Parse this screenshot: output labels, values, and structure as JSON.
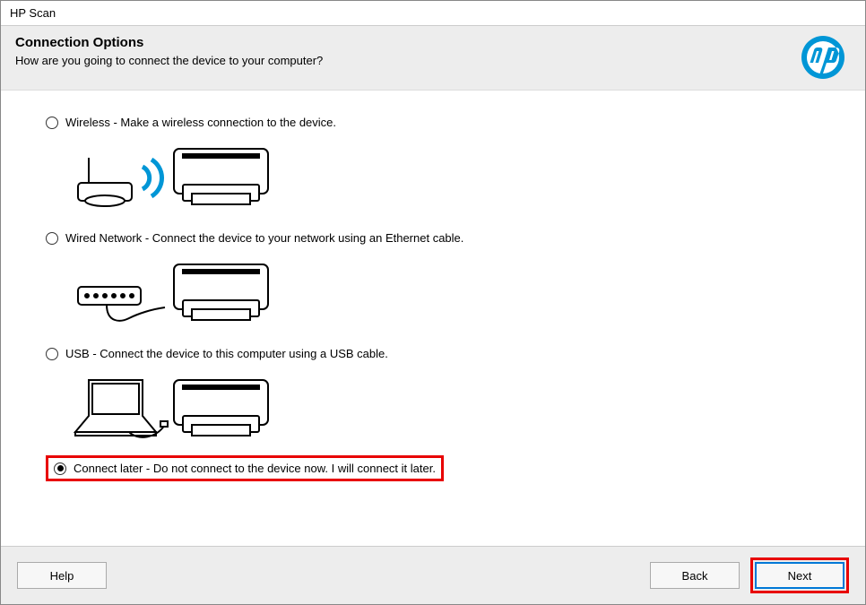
{
  "window": {
    "title": "HP Scan"
  },
  "header": {
    "title": "Connection Options",
    "subtitle": "How are you going to connect the device to your computer?"
  },
  "options": {
    "wireless": {
      "label": "Wireless - Make a wireless connection to the device.",
      "selected": false
    },
    "wired": {
      "label": "Wired Network - Connect the device to your network using an Ethernet cable.",
      "selected": false
    },
    "usb": {
      "label": "USB - Connect the device to this computer using a USB cable.",
      "selected": false
    },
    "later": {
      "label": "Connect later - Do not connect to the device now. I will connect it later.",
      "selected": true
    }
  },
  "buttons": {
    "help": "Help",
    "back": "Back",
    "next": "Next"
  },
  "brand": {
    "logo_name": "hp"
  }
}
